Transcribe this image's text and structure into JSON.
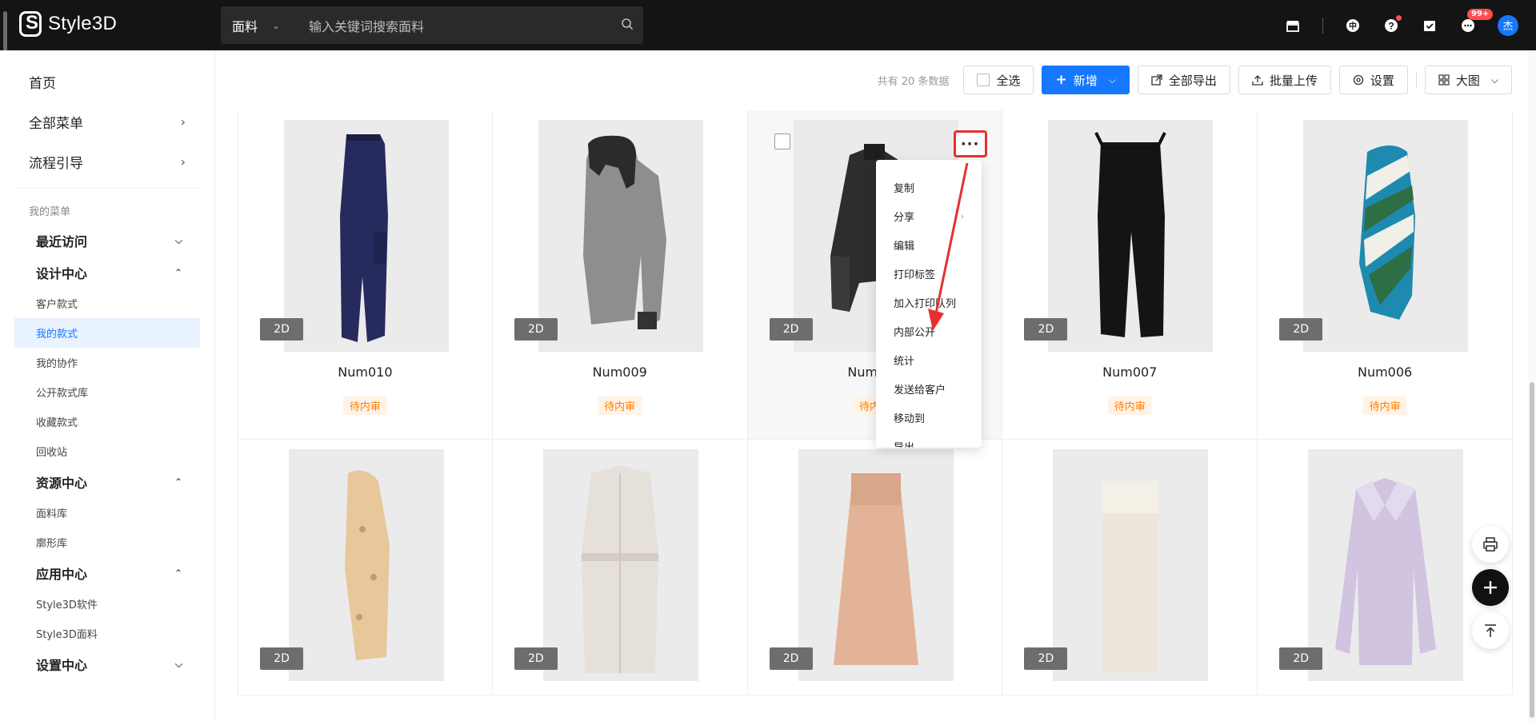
{
  "app": {
    "brand": "Style3D"
  },
  "search": {
    "type": "面料",
    "placeholder": "输入关键词搜索面料"
  },
  "header": {
    "badge": "99+",
    "avatar": "杰",
    "lang": "中"
  },
  "sidebar": {
    "top": [
      {
        "label": "首页"
      },
      {
        "label": "全部菜单"
      },
      {
        "label": "流程引导"
      }
    ],
    "group_title": "我的菜单",
    "sections": [
      {
        "label": "最近访问",
        "items": []
      },
      {
        "label": "设计中心",
        "items": [
          "客户款式",
          "我的款式",
          "我的协作",
          "公开款式库",
          "收藏款式",
          "回收站"
        ]
      },
      {
        "label": "资源中心",
        "items": [
          "面料库",
          "廓形库"
        ]
      },
      {
        "label": "应用中心",
        "items": [
          "Style3D软件",
          "Style3D面料"
        ]
      },
      {
        "label": "设置中心",
        "items": []
      }
    ]
  },
  "toolbar": {
    "total": "共有 20 条数据",
    "select_all": "全选",
    "add": "新增",
    "export_all": "全部导出",
    "batch_upload": "批量上传",
    "settings": "设置",
    "view": "大图"
  },
  "cards_row1": [
    {
      "name": "Num010",
      "status": "待内审",
      "tag": "2D"
    },
    {
      "name": "Num009",
      "status": "待内审",
      "tag": "2D"
    },
    {
      "name": "Num008",
      "status": "待内审",
      "tag": "2D"
    },
    {
      "name": "Num007",
      "status": "待内审",
      "tag": "2D"
    },
    {
      "name": "Num006",
      "status": "待内审",
      "tag": "2D"
    }
  ],
  "cards_row2": [
    {
      "tag": "2D"
    },
    {
      "tag": "2D"
    },
    {
      "tag": "2D"
    },
    {
      "tag": "2D"
    },
    {
      "tag": "2D"
    }
  ],
  "menu": {
    "more": "···",
    "items": [
      "复制",
      "分享",
      "编辑",
      "打印标签",
      "加入打印队列",
      "内部公开",
      "统计",
      "发送给客户",
      "移动到",
      "导出"
    ]
  },
  "colors": {
    "primary": "#1677ff",
    "status": "#ff7d00",
    "annotation": "#e63030"
  }
}
